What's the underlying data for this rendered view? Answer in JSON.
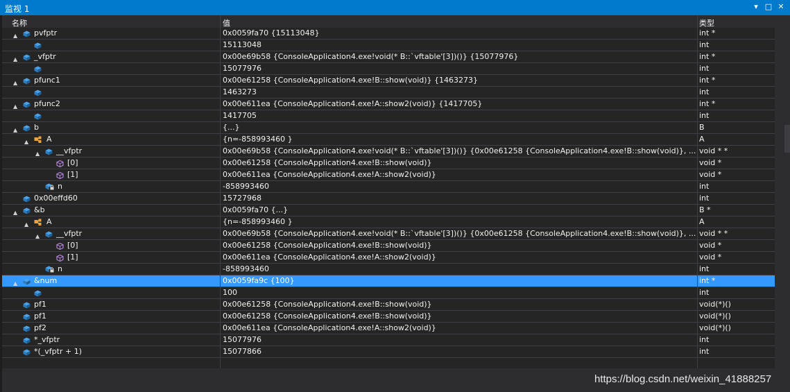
{
  "window": {
    "title": "监视 1"
  },
  "controls": {
    "dropdown": "▾",
    "maximize": "□",
    "close": "✕"
  },
  "columns": {
    "name": "名称",
    "value": "值",
    "type": "类型"
  },
  "rows": [
    {
      "exp": "▲",
      "icon": "field",
      "name": "pvfptr",
      "value": "0x0059fa70 {15113048}",
      "type": "int *"
    },
    {
      "exp": "",
      "icon": "field",
      "name": "",
      "value": "15113048",
      "type": "int"
    },
    {
      "exp": "▲",
      "icon": "field",
      "name": "_vfptr",
      "value": "0x00e69b58 {ConsoleApplication4.exe!void(* B::`vftable'[3])()} {15077976}",
      "type": "int *"
    },
    {
      "exp": "",
      "icon": "field",
      "name": "",
      "value": "15077976",
      "type": "int"
    },
    {
      "exp": "▲",
      "icon": "field",
      "name": "pfunc1",
      "value": "0x00e61258 {ConsoleApplication4.exe!B::show(void)} {1463273}",
      "type": "int *"
    },
    {
      "exp": "",
      "icon": "field",
      "name": "",
      "value": "1463273",
      "type": "int"
    },
    {
      "exp": "▲",
      "icon": "field",
      "name": "pfunc2",
      "value": "0x00e611ea {ConsoleApplication4.exe!A::show2(void)} {1417705}",
      "type": "int *"
    },
    {
      "exp": "",
      "icon": "field",
      "name": "",
      "value": "1417705",
      "type": "int"
    },
    {
      "exp": "▲",
      "icon": "field",
      "name": "b",
      "value": "{...}",
      "type": "B"
    },
    {
      "exp": "▲",
      "icon": "class",
      "name": "A",
      "value": "{n=-858993460 }",
      "type": "A"
    },
    {
      "exp": "▲",
      "icon": "field",
      "name": "__vfptr",
      "value": "0x00e69b58 {ConsoleApplication4.exe!void(* B::`vftable'[3])()} {0x00e61258 {ConsoleApplication4.exe!B::show(void)}, ...}",
      "type": "void * *"
    },
    {
      "exp": "",
      "icon": "cube",
      "name": "[0]",
      "value": "0x00e61258 {ConsoleApplication4.exe!B::show(void)}",
      "type": "void *"
    },
    {
      "exp": "",
      "icon": "cube",
      "name": "[1]",
      "value": "0x00e611ea {ConsoleApplication4.exe!A::show2(void)}",
      "type": "void *"
    },
    {
      "exp": "",
      "icon": "locked",
      "name": "n",
      "value": "-858993460",
      "type": "int"
    },
    {
      "exp": "",
      "icon": "field",
      "name": "0x00effd60",
      "value": "15727968",
      "type": "int"
    },
    {
      "exp": "▲",
      "icon": "field",
      "name": "&b",
      "value": "0x0059fa70 {...}",
      "type": "B *"
    },
    {
      "exp": "▲",
      "icon": "class",
      "name": "A",
      "value": "{n=-858993460 }",
      "type": "A"
    },
    {
      "exp": "▲",
      "icon": "field",
      "name": "__vfptr",
      "value": "0x00e69b58 {ConsoleApplication4.exe!void(* B::`vftable'[3])()} {0x00e61258 {ConsoleApplication4.exe!B::show(void)}, ...}",
      "type": "void * *"
    },
    {
      "exp": "",
      "icon": "cube",
      "name": "[0]",
      "value": "0x00e61258 {ConsoleApplication4.exe!B::show(void)}",
      "type": "void *"
    },
    {
      "exp": "",
      "icon": "cube",
      "name": "[1]",
      "value": "0x00e611ea {ConsoleApplication4.exe!A::show2(void)}",
      "type": "void *"
    },
    {
      "exp": "",
      "icon": "locked",
      "name": "n",
      "value": "-858993460",
      "type": "int"
    },
    {
      "exp": "▲",
      "icon": "field",
      "name": "&num",
      "value": "0x0059fa9c {100}",
      "type": "int *",
      "selected": true
    },
    {
      "exp": "",
      "icon": "field",
      "name": "",
      "value": "100",
      "type": "int"
    },
    {
      "exp": "",
      "icon": "field",
      "name": "pf1",
      "value": "0x00e61258 {ConsoleApplication4.exe!B::show(void)}",
      "type": "void(*)()"
    },
    {
      "exp": "",
      "icon": "field",
      "name": "pf1",
      "value": "0x00e61258 {ConsoleApplication4.exe!B::show(void)}",
      "type": "void(*)()"
    },
    {
      "exp": "",
      "icon": "field",
      "name": "pf2",
      "value": "0x00e611ea {ConsoleApplication4.exe!A::show2(void)}",
      "type": "void(*)()"
    },
    {
      "exp": "",
      "icon": "field",
      "name": "*_vfptr",
      "value": "15077976",
      "type": "int"
    },
    {
      "exp": "",
      "icon": "field",
      "name": "*(_vfptr + 1)",
      "value": "15077866",
      "type": "int"
    },
    {
      "exp": "",
      "icon": "",
      "name": "",
      "value": "",
      "type": ""
    }
  ],
  "watermark": "https://blog.csdn.net/weixin_41888257",
  "colors": {
    "accent": "#007acc",
    "selection": "#3399ff",
    "field_icon": "#4aa3e8",
    "class_icon": "#e8a33d",
    "cube_icon": "#b180d7"
  }
}
